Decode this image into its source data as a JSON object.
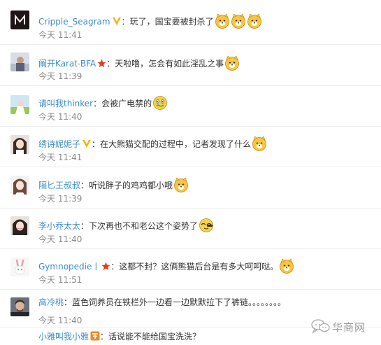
{
  "comments": [
    {
      "user": "Cripple_Seagram",
      "text": "玩了，国宝要被封杀了",
      "time": "今天 11:41"
    },
    {
      "user": "阚开Karat-BFA",
      "text": "天啦噜，怎会有如此淫乱之事",
      "time": "今天 11:39"
    },
    {
      "user": "请叫我thinker",
      "text": "会被广电禁的",
      "time": "今天 11:40"
    },
    {
      "user": "绣诗妮妮子",
      "text": "在大熊猫交配的过程中，记者发现了什么",
      "time": "今天 11:41"
    },
    {
      "user": "隔匕王叔叔",
      "text": "听说胖子的鸡鸡都小哦",
      "time": "今天 11:39"
    },
    {
      "user": "李小乔太太",
      "text": "下次再也不和老公这个姿势了",
      "time": "今天 11:40"
    },
    {
      "user": "Gymnopedie丨",
      "text": "这都不封？这俩熊猫后台是有多大呵呵哒。",
      "time": "今天 11:51"
    },
    {
      "user": "高冷桃",
      "text": "蓝色饲养员在铁栏外一边看一边默默拉下了裤链。。。。。。。。",
      "time": "今天 11:40"
    },
    {
      "user": "小雅叫我小雅",
      "text": "话说能不能给国宝洗洗？",
      "time": ""
    }
  ],
  "watermark": {
    "text": "华商网",
    "icon": "chat-bubbles-icon"
  },
  "colors": {
    "username": "#3b8ec8",
    "time": "#8a8a8a",
    "verified": "#f5b400",
    "star": "#e23b1e",
    "divider": "#ececec"
  }
}
